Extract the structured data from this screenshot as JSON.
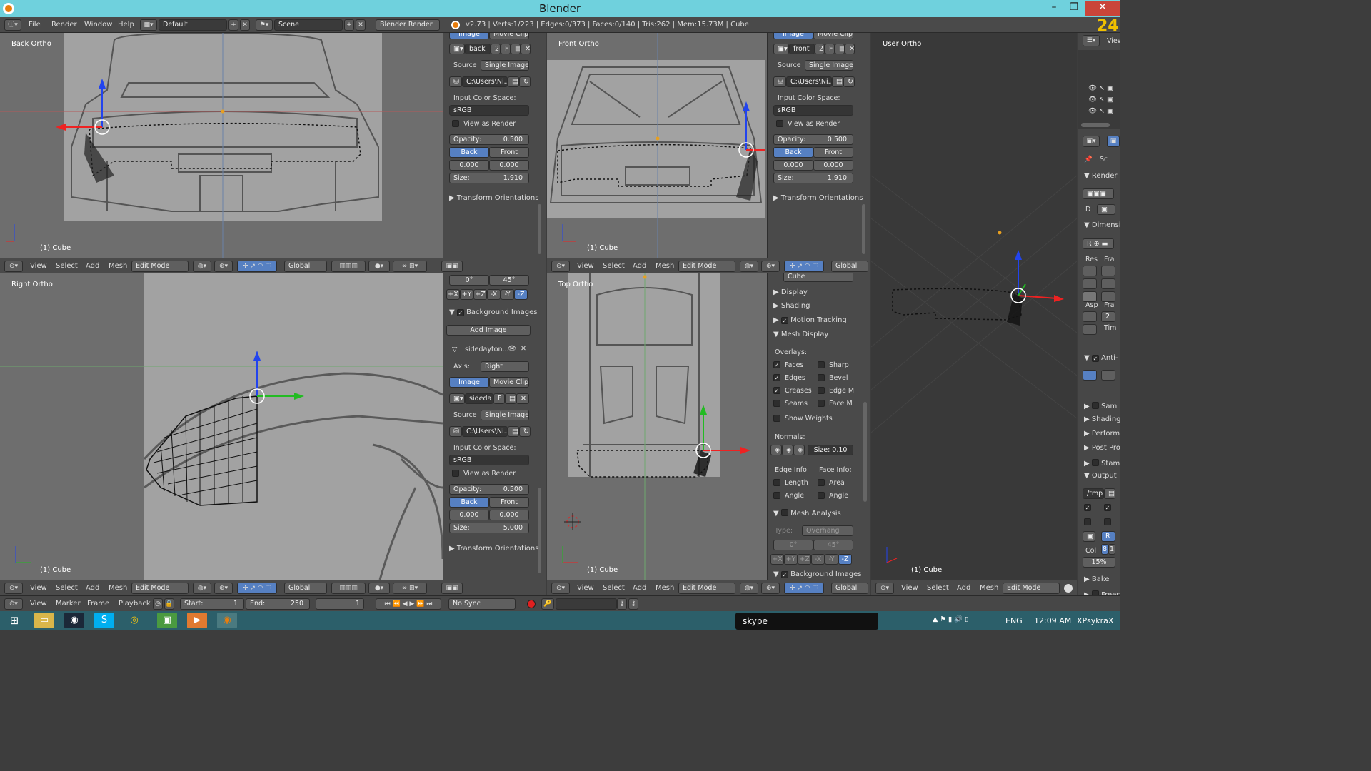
{
  "window": {
    "title": "Blender",
    "frame_number": "24"
  },
  "menu": {
    "file": "File",
    "render": "Render",
    "window": "Window",
    "help": "Help",
    "layout": "Default",
    "scene": "Scene",
    "engine": "Blender Render",
    "stats": "v2.73 | Verts:1/223 | Edges:0/373 | Faces:0/140 | Tris:262 | Mem:15.73M | Cube"
  },
  "viewports": {
    "back": {
      "label": "Back Ortho",
      "object": "(1) Cube"
    },
    "front": {
      "label": "Front Ortho",
      "object": "(1) Cube"
    },
    "user": {
      "label": "User Ortho",
      "object": "(1) Cube"
    },
    "right": {
      "label": "Right Ortho",
      "object": "(1) Cube"
    },
    "top": {
      "label": "Top Ortho",
      "object": "(1) Cube"
    }
  },
  "header": {
    "view": "View",
    "select": "Select",
    "add": "Add",
    "mesh": "Mesh",
    "mode": "Edit Mode",
    "orientation": "Global"
  },
  "bg_panel_back": {
    "tab_image": "Image",
    "tab_movie": "Movie Clip",
    "name": "back",
    "users": "2",
    "fake": "F",
    "source_label": "Source",
    "source": "Single Image",
    "path": "C:\\Users\\Ni...",
    "ics_label": "Input Color Space:",
    "ics": "sRGB",
    "view_as_render": "View as Render",
    "opacity_label": "Opacity:",
    "opacity": "0.500",
    "back": "Back",
    "front": "Front",
    "x": "0.000",
    "y": "0.000",
    "size_label": "Size:",
    "size": "1.910",
    "transform": "Transform Orientations"
  },
  "bg_panel_front": {
    "tab_image": "Image",
    "tab_movie": "Movie Clip",
    "name": "front",
    "users": "2",
    "fake": "F",
    "source_label": "Source",
    "source": "Single Image",
    "path": "C:\\Users\\Ni...",
    "ics_label": "Input Color Space:",
    "ics": "sRGB",
    "view_as_render": "View as Render",
    "opacity_label": "Opacity:",
    "opacity": "0.500",
    "back": "Back",
    "front": "Front",
    "x": "0.000",
    "y": "0.000",
    "size_label": "Size:",
    "size": "1.910",
    "transform": "Transform Orientations"
  },
  "bg_panel_right": {
    "angle1": "0°",
    "angle2": "45°",
    "axes": [
      "+X",
      "+Y",
      "+Z",
      "-X",
      "-Y",
      "-Z"
    ],
    "bg_title": "Background Images",
    "add_image": "Add Image",
    "item_name": "sidedayton...",
    "axis_label": "Axis:",
    "axis": "Right",
    "tab_image": "Image",
    "tab_movie": "Movie Clip",
    "name": "sideda",
    "fake": "F",
    "source_label": "Source",
    "source": "Single Image",
    "path": "C:\\Users\\Ni...",
    "ics_label": "Input Color Space:",
    "ics": "sRGB",
    "view_as_render": "View as Render",
    "opacity_label": "Opacity:",
    "opacity": "0.500",
    "back": "Back",
    "front": "Front",
    "x": "0.000",
    "y": "0.000",
    "size_label": "Size:",
    "size": "5.000",
    "transform": "Transform Orientations"
  },
  "mesh_panel": {
    "object": "Cube",
    "display": "Display",
    "shading": "Shading",
    "motion_tracking": "Motion Tracking",
    "mesh_display": "Mesh Display",
    "overlays": "Overlays:",
    "faces": "Faces",
    "sharp": "Sharp",
    "edges": "Edges",
    "bevel": "Bevel",
    "creases": "Creases",
    "edge_m": "Edge M",
    "seams": "Seams",
    "face_m": "Face M",
    "show_weights": "Show Weights",
    "normals": "Normals:",
    "normal_size": "Size: 0.10",
    "edge_info": "Edge Info:",
    "face_info": "Face Info:",
    "length": "Length",
    "area": "Area",
    "angle1": "Angle",
    "angle2": "Angle",
    "mesh_analysis": "Mesh Analysis",
    "type_label": "Type:",
    "type": "Overhang",
    "a1": "0°",
    "a2": "45°",
    "axes": [
      "+X",
      "+Y",
      "+Z",
      "-X",
      "-Y",
      "-Z"
    ],
    "bg_images": "Background Images"
  },
  "props": {
    "view": "View",
    "sc": "Sc",
    "render": "Render",
    "d": "D",
    "dimensi": "Dimensi",
    "r": "R",
    "res": "Res",
    "fra": "Fra",
    "asp": "Asp",
    "fra2": "Fra",
    "tim": "Tim",
    "two": "2",
    "anti": "Anti-",
    "sam": "Sam",
    "shading": "Shading",
    "performa": "Performa",
    "post": "Post Proc",
    "stam": "Stam",
    "output": "Output",
    "tmp": "/tmp\\",
    "col": "Col",
    "eight": "8",
    "one": "1",
    "pct": "15%",
    "bake": "Bake",
    "frees": "Frees"
  },
  "timeline": {
    "view": "View",
    "marker": "Marker",
    "frame": "Frame",
    "playback": "Playback",
    "start_label": "Start:",
    "start": "1",
    "end_label": "End:",
    "end": "250",
    "current": "1",
    "sync": "No Sync"
  },
  "taskbar": {
    "lang": "ENG",
    "time": "12:09 AM",
    "user": "XPsykraX",
    "skype": "skype"
  }
}
